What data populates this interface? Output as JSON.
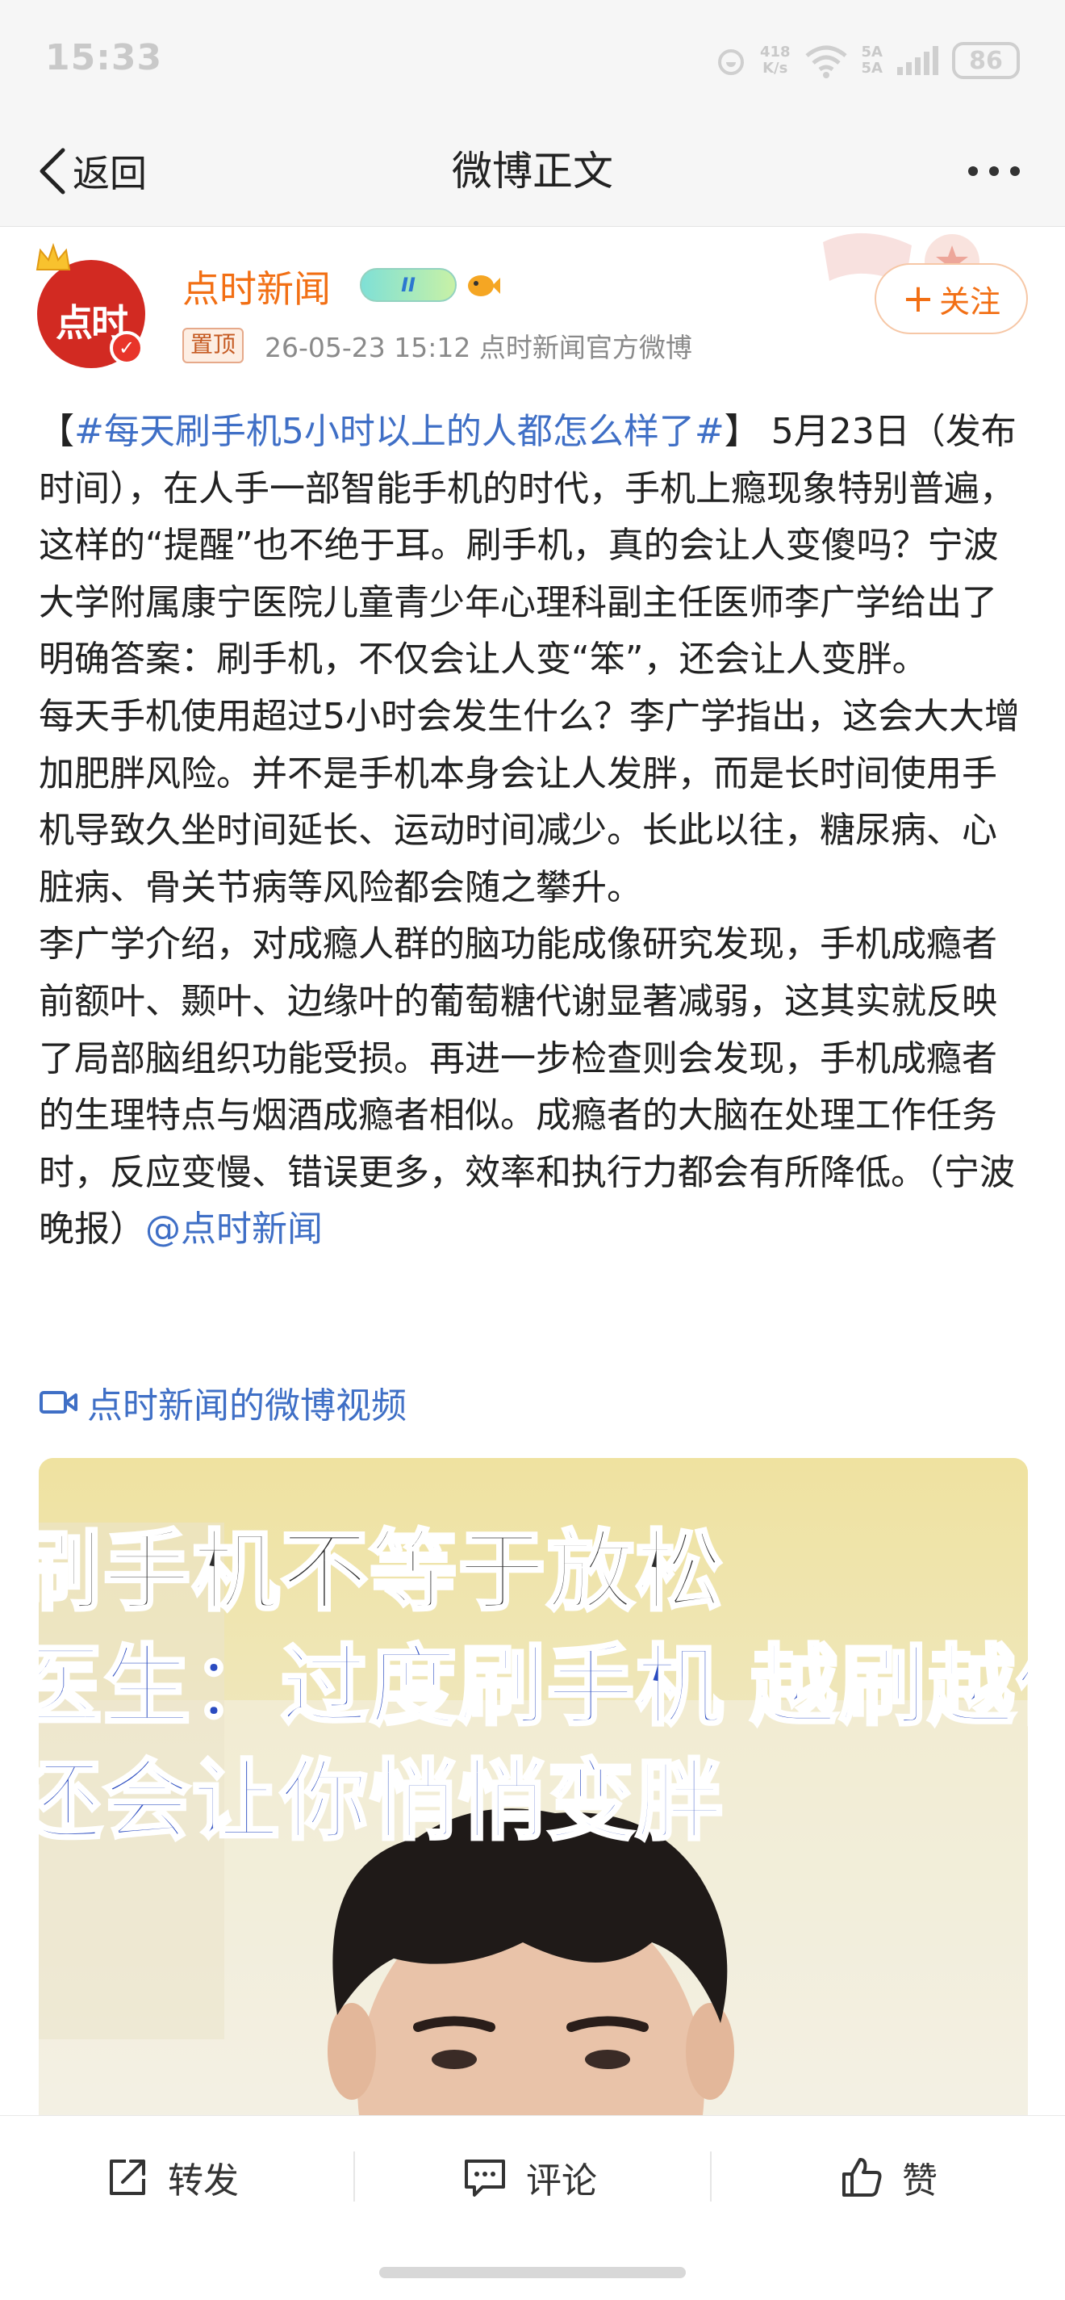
{
  "status_bar": {
    "time": "15:33",
    "net_speed_value": "418",
    "net_speed_unit": "K/s",
    "signal1": "5A",
    "signal2": "5A",
    "battery": "86"
  },
  "nav": {
    "back_label": "返回",
    "title": "微博正文"
  },
  "author": {
    "avatar_text": "点时",
    "name": "点时新闻",
    "level_badge": "II",
    "pinned_label": "置顶",
    "meta": "26-05-23 15:12  点时新闻官方微博",
    "follow_label": "关注",
    "follow_plus": "+"
  },
  "post": {
    "bracket_open": "【",
    "hashtag": "#每天刷手机5小时以上的人都怎么样了#",
    "para1": "】 5月23日（发布时间），在人手一部智能手机的时代，手机上瘾现象特别普遍，这样的“提醒”也不绝于耳。刷手机，真的会让人变傻吗？宁波大学附属康宁医院儿童青少年心理科副主任医师李广学给出了明确答案：刷手机，不仅会让人变“笨”，还会让人变胖。",
    "para2": "每天手机使用超过5小时会发生什么？李广学指出，这会大大增加肥胖风险。并不是手机本身会让人发胖，而是长时间使用手机导致久坐时间延长、运动时间减少。长此以往，糖尿病、心脏病、骨关节病等风险都会随之攀升。",
    "para3": "李广学介绍，对成瘾人群的脑功能成像研究发现，手机成瘾者前额叶、颞叶、边缘叶的葡萄糖代谢显著减弱，这其实就反映了局部脑组织功能受损。再进一步检查则会发现，手机成瘾者的生理特点与烟酒成瘾者相似。成瘾者的大脑在处理工作任务时，反应变慢、错误更多，效率和执行力都会有所降低。（宁波晚报）",
    "mention": "@点时新闻",
    "video_link": "点时新闻的微博视频"
  },
  "video": {
    "caption_line1": "刷手机不等于放松",
    "caption_line2": "医生：过度刷手机 越刷越傻",
    "caption_line3": "还会让你悄悄变胖"
  },
  "actions": {
    "repost": "转发",
    "comment": "评论",
    "like": "赞"
  },
  "colors": {
    "accent_orange": "#f26f14",
    "link_blue": "#3f6fc6",
    "avatar_red": "#d22a22"
  }
}
